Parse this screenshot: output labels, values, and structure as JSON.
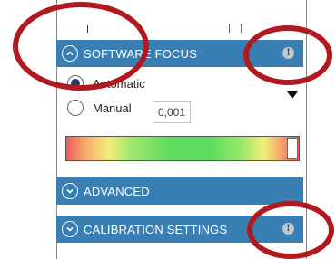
{
  "sections": {
    "software_focus": {
      "title": "SOFTWARE FOCUS",
      "info": "!"
    },
    "advanced": {
      "title": "ADVANCED"
    },
    "calibration": {
      "title": "CALIBRATION SETTINGS",
      "info": "!"
    }
  },
  "focus_mode": {
    "options": [
      "Automatic",
      "Manual"
    ],
    "selected": "Automatic",
    "manual_value": "0,001"
  },
  "colors": {
    "header_blue": "#3a7fb4",
    "annotation_red": "#b2191f",
    "radio_selected": "#1f3f6e"
  },
  "icons": {
    "software_focus_chevron": "chevron-up-icon",
    "advanced_chevron": "chevron-down-icon",
    "calibration_chevron": "chevron-down-icon",
    "info": "info-icon",
    "dropdown": "dropdown-arrow-icon"
  }
}
